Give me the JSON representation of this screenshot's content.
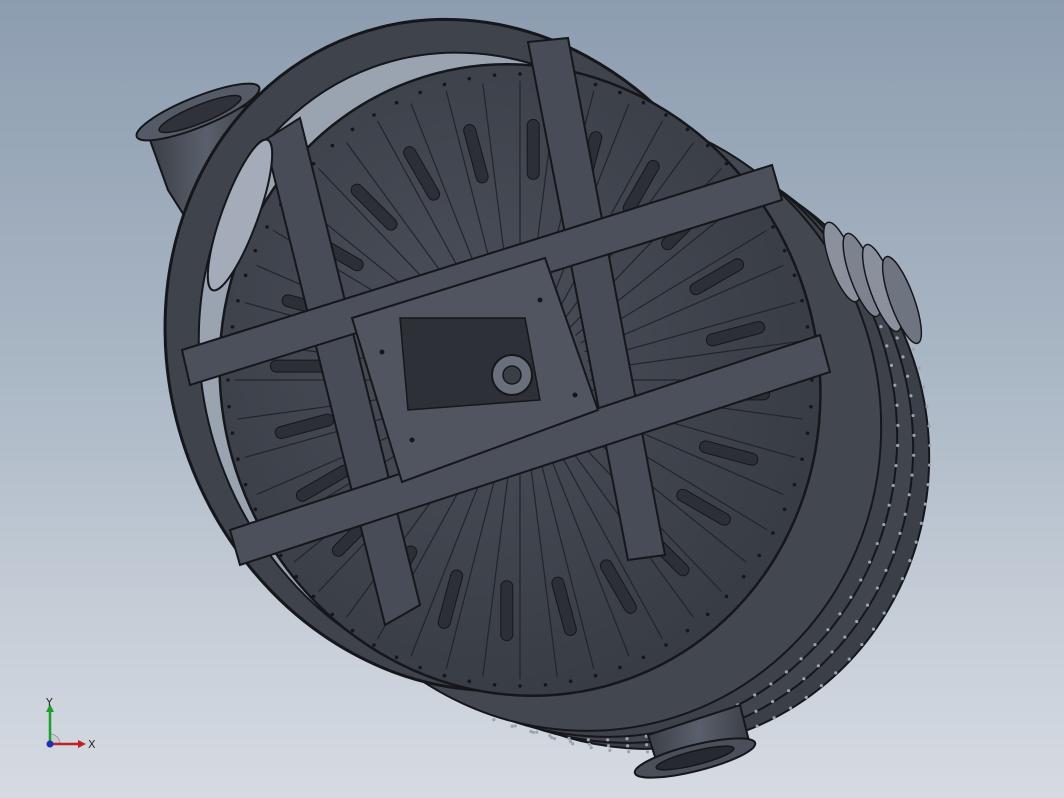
{
  "viewport": {
    "background_top": "#8d9db0",
    "background_bottom": "#d6dbe2"
  },
  "model": {
    "part_fill": "#414650",
    "edge_color": "#15171b",
    "highlight": "#5e6470"
  },
  "triad": {
    "x_label": "X",
    "y_label": "Y",
    "x_color": "#c0231e",
    "y_color": "#1f9e2a",
    "z_color": "#1c2fb8"
  }
}
